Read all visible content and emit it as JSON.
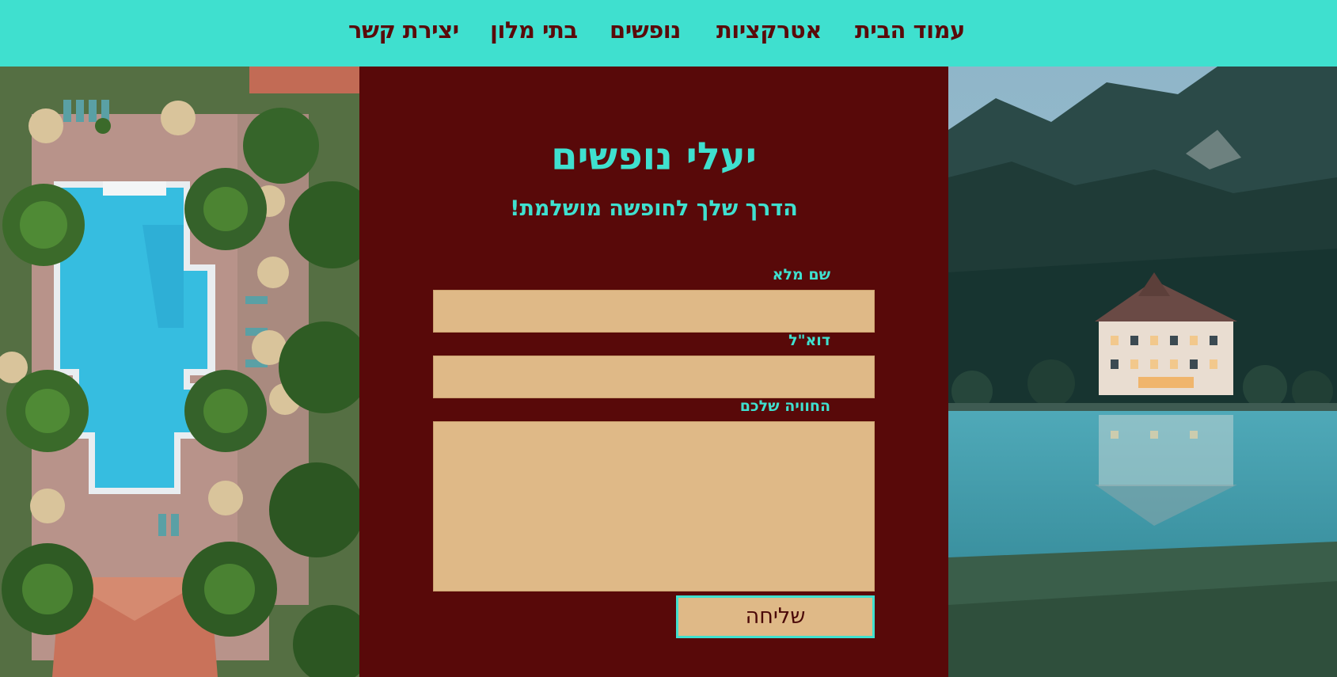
{
  "nav": {
    "items": [
      {
        "label": "עמוד הבית"
      },
      {
        "label": "אטרקציות"
      },
      {
        "label": "נופשים"
      },
      {
        "label": "בתי מלון"
      },
      {
        "label": "יצירת קשר"
      }
    ]
  },
  "hero": {
    "title": "יעלי נופשים",
    "subtitle": "הדרך שלך לחופשה מושלמת!"
  },
  "form": {
    "fullname_label": "שם מלא",
    "fullname_value": "",
    "email_label": "דוא\"ל",
    "email_value": "",
    "experience_label": "החוויה שלכם",
    "experience_value": "",
    "submit_label": "שליחה"
  },
  "colors": {
    "nav_background": "#3fe0cf",
    "panel_background": "#580909",
    "accent_text": "#3fe0cf",
    "field_background": "#dfb987",
    "nav_text": "#5a0a0a"
  }
}
